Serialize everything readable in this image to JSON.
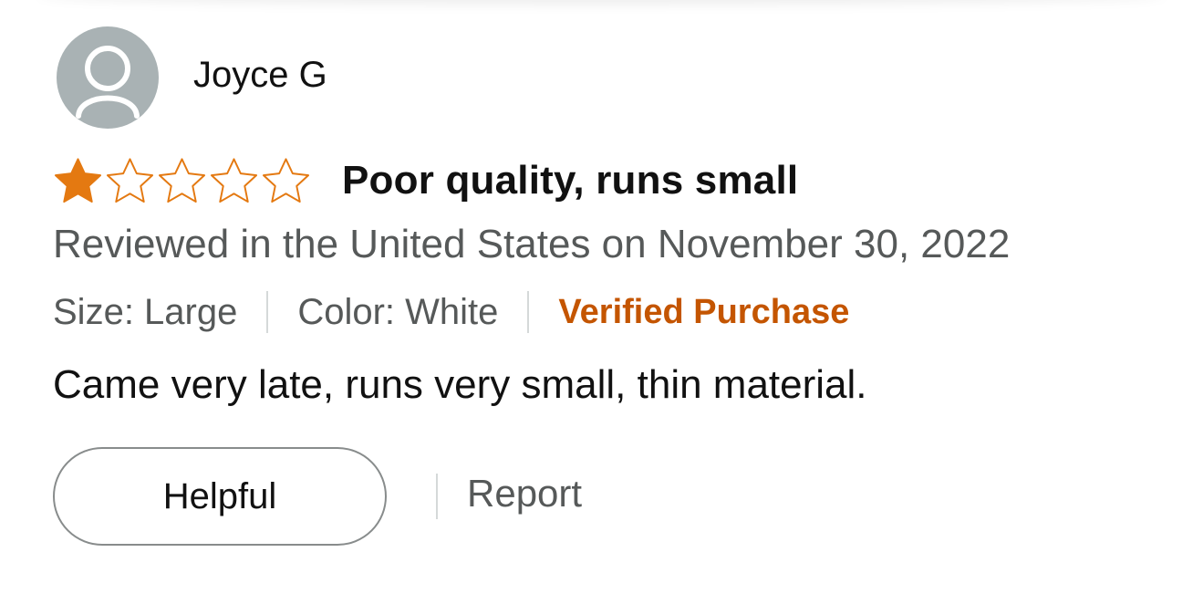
{
  "review": {
    "author": "Joyce G",
    "avatar_icon": "default-user-avatar-icon",
    "rating": 1,
    "rating_max": 5,
    "title": "Poor quality, runs small",
    "date_text": "Reviewed in the United States on November 30, 2022",
    "size": "Size: Large",
    "color": "Color: White",
    "verified": "Verified Purchase",
    "body": "Came very late, runs very small, thin material.",
    "helpful_label": "Helpful",
    "report_label": "Report"
  },
  "colors": {
    "star_fill": "#e47911",
    "verified_text": "#c45500",
    "avatar_bg": "#a9b2b4",
    "secondary_text": "#565959"
  }
}
